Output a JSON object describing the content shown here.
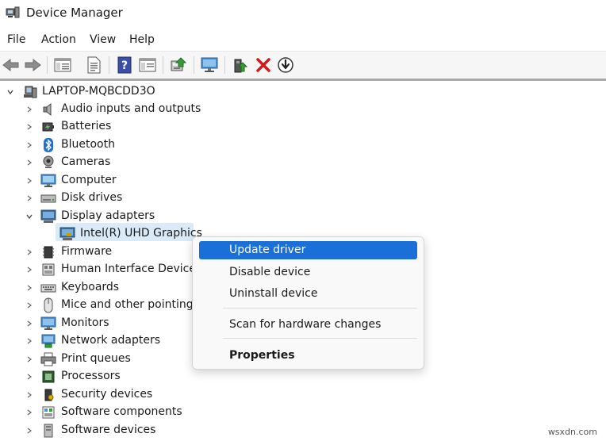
{
  "window": {
    "title": "Device Manager"
  },
  "menu": [
    "File",
    "Action",
    "View",
    "Help"
  ],
  "toolbar": {
    "buttons": [
      "back-arrow-icon",
      "forward-arrow-icon",
      "properties-window-icon",
      "document-icon",
      "help-icon",
      "details-window-icon",
      "scan-hardware-icon",
      "monitor-icon",
      "enable-device-icon",
      "uninstall-x-icon",
      "update-driver-icon"
    ]
  },
  "tree": {
    "root": "LAPTOP-MQBCDD3O",
    "categories": [
      "Audio inputs and outputs",
      "Batteries",
      "Bluetooth",
      "Cameras",
      "Computer",
      "Disk drives",
      "Display adapters",
      "Firmware",
      "Human Interface Devices",
      "Keyboards",
      "Mice and other pointing",
      "Monitors",
      "Network adapters",
      "Print queues",
      "Processors",
      "Security devices",
      "Software components",
      "Software devices"
    ],
    "expanded_child": "Intel(R) UHD Graphics"
  },
  "context_menu": {
    "items": [
      "Update driver",
      "Disable device",
      "Uninstall device",
      "Scan for hardware changes",
      "Properties"
    ],
    "highlighted": "Update driver"
  },
  "colors": {
    "highlight": "#1a6fd8",
    "selection": "#d9ebf9"
  },
  "watermark": "wsxdn.com"
}
